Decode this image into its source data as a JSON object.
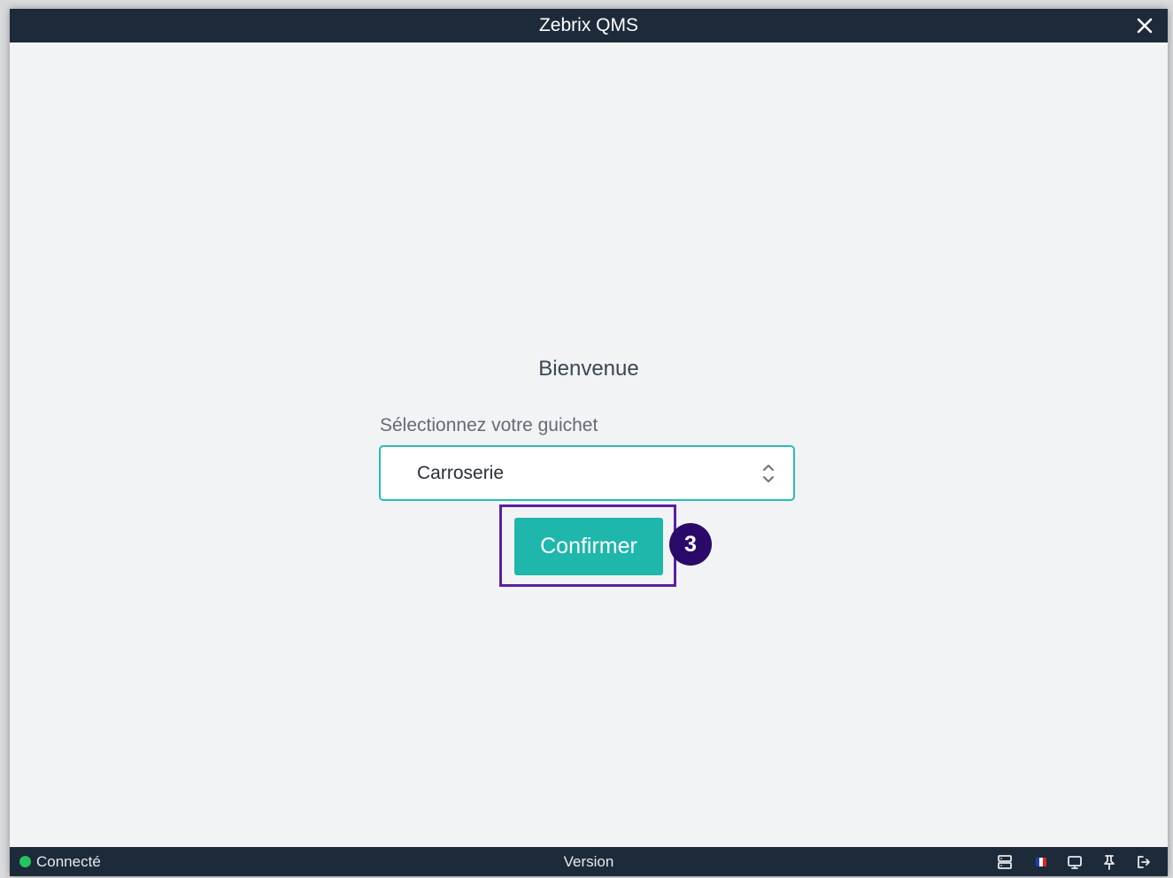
{
  "window": {
    "title": "Zebrix QMS"
  },
  "main": {
    "welcome": "Bienvenue",
    "select_label": "Sélectionnez votre guichet",
    "selected_counter": "Carroserie",
    "confirm_label": "Confirmer",
    "step_badge": "3"
  },
  "statusbar": {
    "connection_status": "Connecté",
    "version_label": "Version",
    "icons": [
      "server-icon",
      "french-flag-icon",
      "display-icon",
      "pin-icon",
      "logout-icon"
    ]
  },
  "colors": {
    "titlebar": "#1d2a3a",
    "accent": "#1fb6ac",
    "select_border": "#2bbbb3",
    "highlight": "#5b1fa0",
    "badge": "#2a0a69",
    "connected": "#22c55e"
  }
}
